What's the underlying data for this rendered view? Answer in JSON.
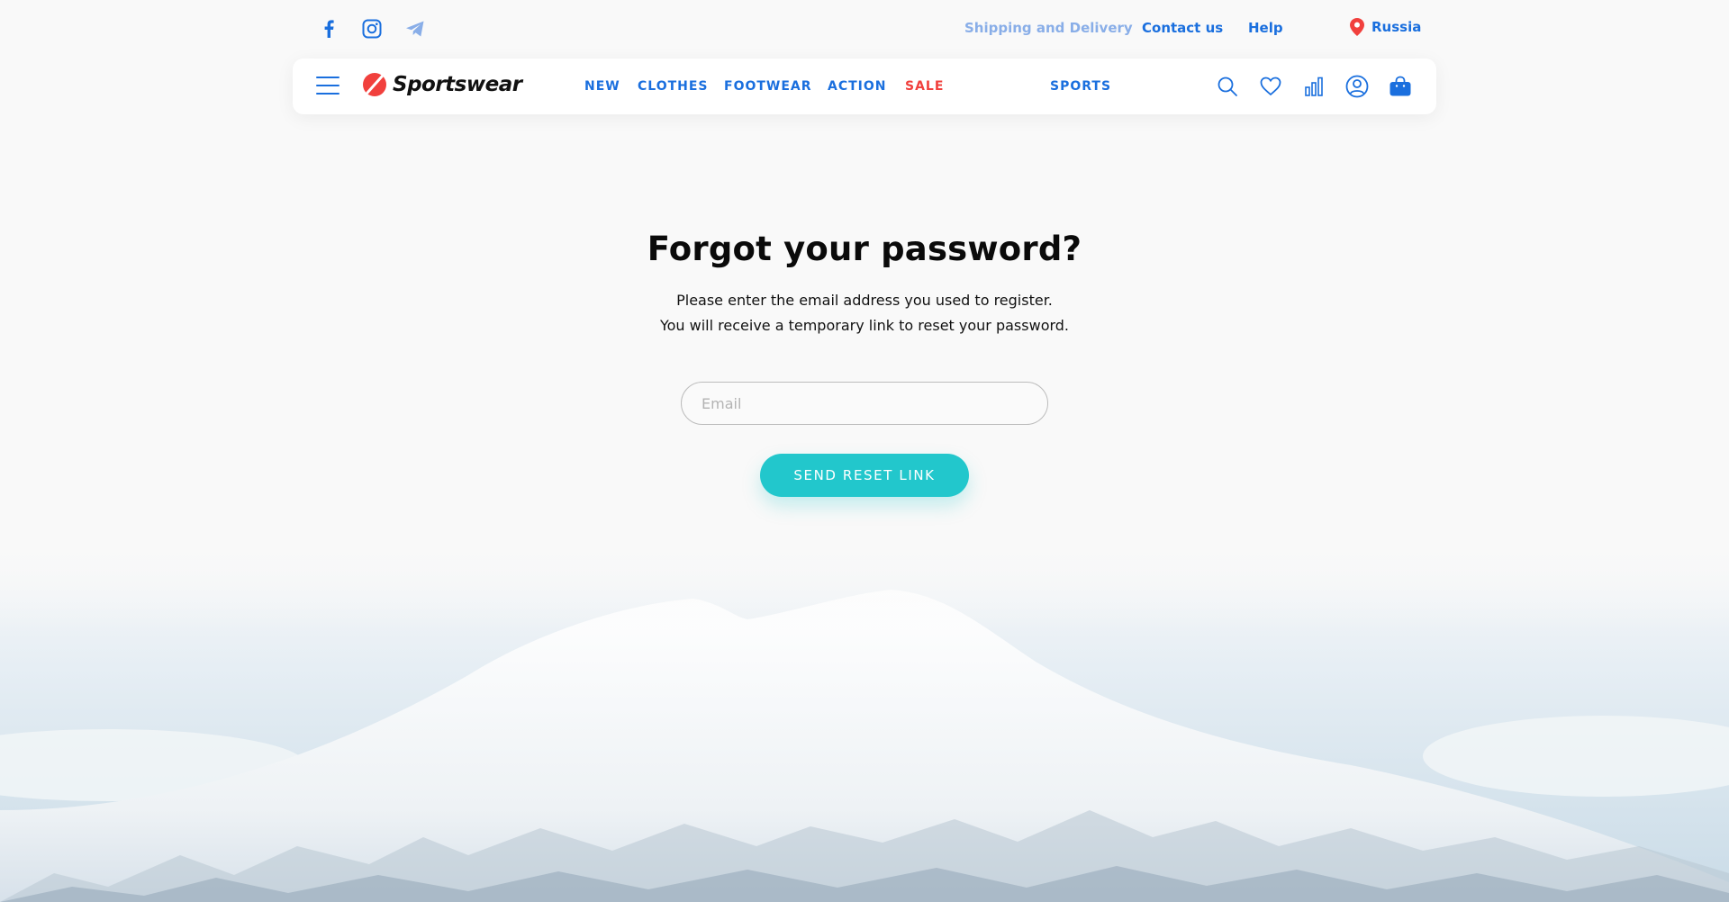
{
  "topbar": {
    "social": [
      "facebook-icon",
      "instagram-icon",
      "telegram-icon"
    ],
    "links": {
      "shipping": "Shipping and Delivery",
      "contact": "Contact us",
      "help": "Help"
    },
    "region": "Russia"
  },
  "nav": {
    "logo": "Sportswear",
    "menu": {
      "new": "NEW",
      "clothes": "CLOTHES",
      "footwear": "FOOTWEAR",
      "action": "ACTION",
      "sale": "SALE",
      "sports": "SPORTS"
    },
    "tools": [
      "search-icon",
      "heart-icon",
      "stats-icon",
      "user-icon",
      "bag-icon"
    ]
  },
  "form": {
    "title": "Forgot your password?",
    "line1": "Please enter the email address you used to register.",
    "line2": "You will receive a temporary link to reset your password.",
    "email_placeholder": "Email",
    "email_value": "",
    "button": "SEND RESET LINK"
  },
  "colors": {
    "brand_blue": "#1a6fde",
    "light_blue": "#89aee8",
    "sale_red": "#f1403d",
    "accent_teal": "#22c7cc",
    "logo_red": "#f1403d"
  }
}
